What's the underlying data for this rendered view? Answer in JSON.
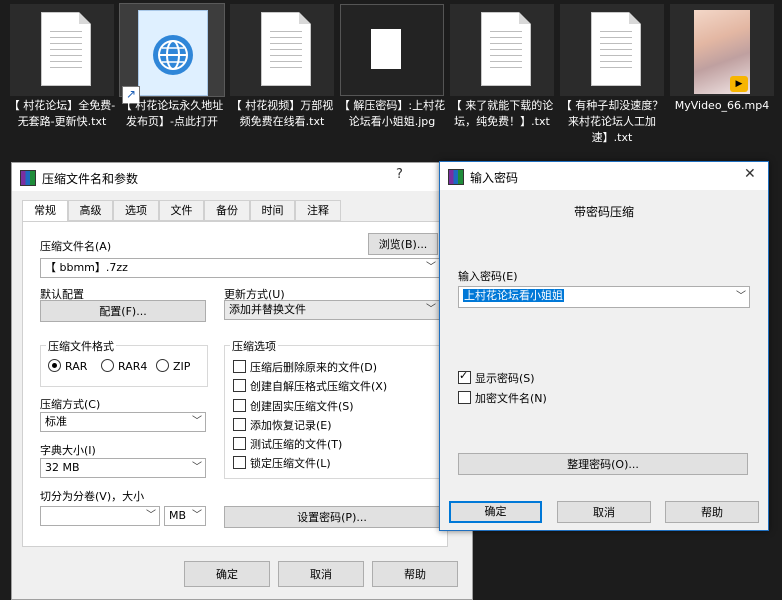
{
  "desktop": {
    "files": [
      {
        "name": "【 村花论坛】全免费-无套路-更新快.txt",
        "icon": "text-file-icon"
      },
      {
        "name": "【 村花论坛永久地址发布页】-点此打开",
        "icon": "internet-shortcut-icon"
      },
      {
        "name": "【 村花视频】万部视频免费在线看.txt",
        "icon": "text-file-icon"
      },
      {
        "name": "【 解压密码】:上村花论坛看小姐姐.jpg",
        "icon": "image-file-icon"
      },
      {
        "name": "【 来了就能下载的论坛，纯免费！】.txt",
        "icon": "text-file-icon"
      },
      {
        "name": "【 有种子却没速度？来村花论坛人工加速】.txt",
        "icon": "text-file-icon"
      },
      {
        "name": "MyVideo_66.mp4",
        "icon": "video-thumbnail-icon"
      }
    ]
  },
  "archive_dialog": {
    "title": "压缩文件名和参数",
    "help_glyph": "?",
    "close_glyph": "✕",
    "tabs": [
      "常规",
      "高级",
      "选项",
      "文件",
      "备份",
      "时间",
      "注释"
    ],
    "archive_name_label": "压缩文件名(A)",
    "browse_button": "浏览(B)...",
    "archive_name_value": "【 bbmm】.7zz",
    "default_profile_label": "默认配置",
    "profile_button": "配置(F)...",
    "update_mode_label": "更新方式(U)",
    "update_mode_value": "添加并替换文件",
    "format_group_label": "压缩文件格式",
    "formats": [
      {
        "label": "RAR",
        "checked": true
      },
      {
        "label": "RAR4",
        "checked": false
      },
      {
        "label": "ZIP",
        "checked": false
      }
    ],
    "method_label": "压缩方式(C)",
    "method_value": "标准",
    "dict_label": "字典大小(I)",
    "dict_value": "32 MB",
    "split_label": "切分为分卷(V)，大小",
    "split_value": "",
    "split_unit": "MB",
    "options_group_label": "压缩选项",
    "options": [
      {
        "label": "压缩后删除原来的文件(D)",
        "checked": false
      },
      {
        "label": "创建自解压格式压缩文件(X)",
        "checked": false
      },
      {
        "label": "创建固实压缩文件(S)",
        "checked": false
      },
      {
        "label": "添加恢复记录(E)",
        "checked": false
      },
      {
        "label": "测试压缩的文件(T)",
        "checked": false
      },
      {
        "label": "锁定压缩文件(L)",
        "checked": false
      }
    ],
    "set_password_button": "设置密码(P)...",
    "ok_button": "确定",
    "cancel_button": "取消",
    "help_button": "帮助"
  },
  "password_dialog": {
    "title": "输入密码",
    "close_glyph": "✕",
    "heading": "带密码压缩",
    "password_label": "输入密码(E)",
    "password_value": "上村花论坛看小姐姐",
    "show_password_label": "显示密码(S)",
    "show_password_checked": true,
    "encrypt_names_label": "加密文件名(N)",
    "encrypt_names_checked": false,
    "organize_button": "整理密码(O)...",
    "ok_button": "确定",
    "cancel_button": "取消",
    "help_button": "帮助"
  },
  "colors": {
    "accent": "#0078d7",
    "desktop_bg": "#1c1c1c",
    "dialog_bg": "#f0f0f0"
  }
}
